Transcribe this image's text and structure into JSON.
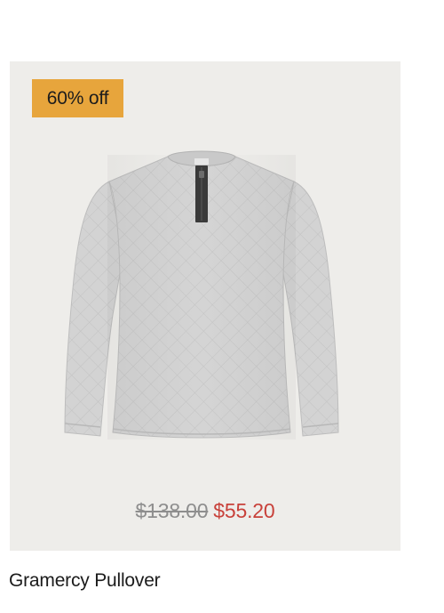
{
  "product": {
    "discount_label": "60% off",
    "original_price": "$138.00",
    "sale_price": "$55.20",
    "name": "Gramercy Pullover",
    "image_icon": "pullover-sweater-image"
  },
  "colors": {
    "badge_background": "#e7a53c",
    "panel_background": "#eeedea",
    "sale_price": "#c8413a",
    "original_price": "#8e8e8e",
    "sweater_body": "#cfcfcf",
    "zipper_placket": "#3a3a3a"
  }
}
